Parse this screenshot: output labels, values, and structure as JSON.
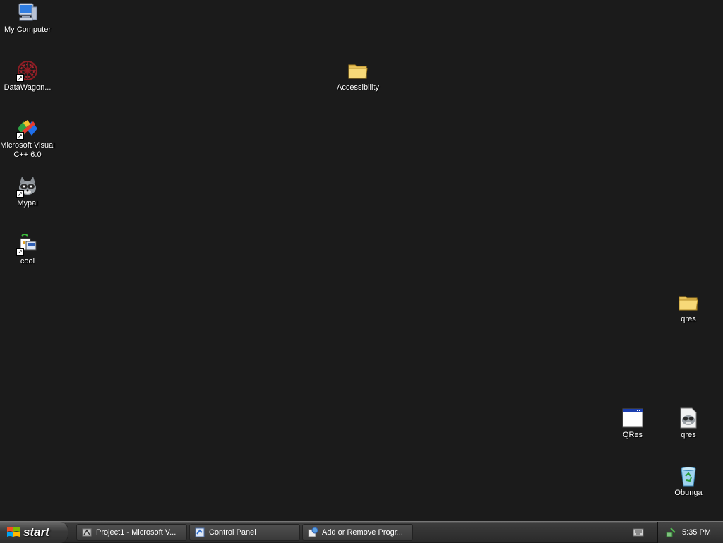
{
  "desktop": {
    "icons": {
      "my_computer": "My Computer",
      "datawagon": "DataWagon...",
      "msvc": "Microsoft Visual C++ 6.0",
      "mypal": "Mypal",
      "cool": "cool",
      "accessibility": "Accessibility",
      "qres_folder": "qres",
      "qres_app": "QRes",
      "qres_file": "qres",
      "recycle_bin": "Obunga"
    }
  },
  "taskbar": {
    "start_label": "start",
    "tasks": [
      {
        "label": "Project1 - Microsoft V...",
        "icon": "vb-project-icon"
      },
      {
        "label": "Control Panel",
        "icon": "control-panel-icon"
      },
      {
        "label": "Add or Remove Progr...",
        "icon": "add-remove-programs-icon"
      }
    ],
    "clock": "5:35 PM"
  },
  "colors": {
    "desktop_bg": "#1b1b1b",
    "taskbar": "#333333",
    "text": "#ffffff"
  }
}
